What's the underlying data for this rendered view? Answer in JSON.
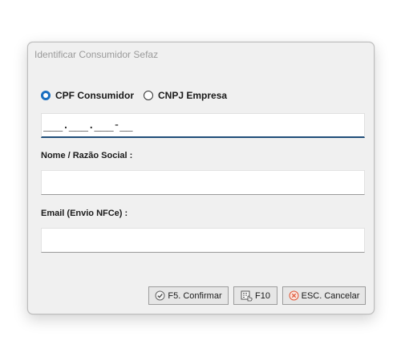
{
  "dialog": {
    "title": "Identificar Consumidor Sefaz"
  },
  "document_type": {
    "options": [
      {
        "label": "CPF Consumidor",
        "selected": true
      },
      {
        "label": "CNPJ Empresa",
        "selected": false
      }
    ]
  },
  "cpf_field": {
    "value": "___.___.___-__"
  },
  "name_field": {
    "label": "Nome / Razão Social :",
    "value": ""
  },
  "email_field": {
    "label": "Email (Envio NFCe) :",
    "value": ""
  },
  "buttons": {
    "confirm": {
      "label": "F5. Confirmar",
      "icon": "check-circle-icon"
    },
    "f10": {
      "label": "F10",
      "icon": "keypad-hand-icon"
    },
    "cancel": {
      "label": "ESC. Cancelar",
      "icon": "cancel-circle-icon"
    }
  },
  "colors": {
    "accent": "#1a6fc0",
    "input_focus_border": "#1f4e79",
    "dialog_bg": "#f0f0f0",
    "cancel_icon": "#e05a3a"
  }
}
